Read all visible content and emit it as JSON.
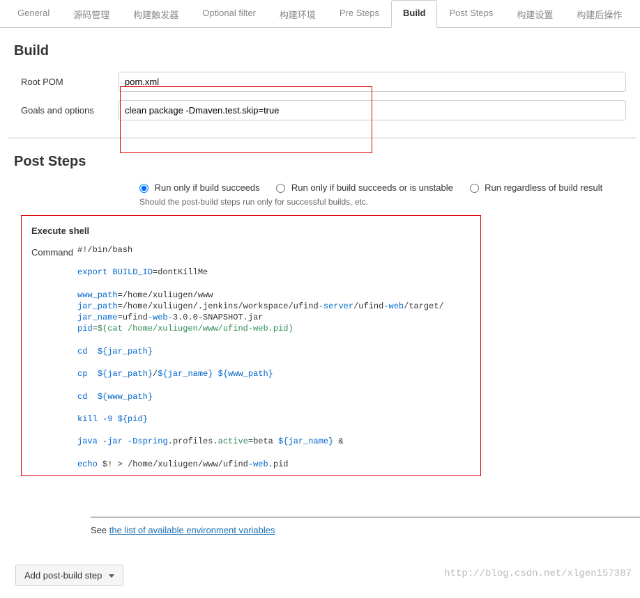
{
  "tabs": {
    "general": "General",
    "scm": "源码管理",
    "triggers": "构建触发器",
    "optional_filter": "Optional filter",
    "env": "构建环境",
    "pre_steps": "Pre Steps",
    "build": "Build",
    "post_steps": "Post Steps",
    "build_settings": "构建设置",
    "post_build": "构建后操作"
  },
  "build": {
    "title": "Build",
    "root_pom_label": "Root POM",
    "root_pom_value": "pom.xml",
    "goals_label": "Goals and options",
    "goals_value": "clean package -Dmaven.test.skip=true"
  },
  "post_steps": {
    "title": "Post Steps",
    "radio_succeeds": "Run only if build succeeds",
    "radio_unstable": "Run only if build succeeds or is unstable",
    "radio_regardless": "Run regardless of build result",
    "help_text": "Should the post-build steps run only for successful builds, etc.",
    "execute_shell_title": "Execute shell",
    "command_label": "Command",
    "shell": {
      "shebang": "#!/bin/bash",
      "export_kw": "export",
      "build_id_var": "BUILD_ID",
      "build_id_val": "dontKillMe",
      "www_path_var": "www_path",
      "www_path_val": "/home/xuliugen/www",
      "jar_path_var": "jar_path",
      "jar_path_val_pre": "/home/xuliugen/.jenkins/workspace/ufind",
      "jar_path_val_srv": "-server",
      "jar_path_val_mid": "/ufind",
      "jar_path_val_web": "-web",
      "jar_path_val_post": "/target/",
      "jar_name_var": "jar_name",
      "jar_name_val_pre": "ufind",
      "jar_name_val_web": "-web-",
      "jar_name_val_post": "3.0.0-SNAPSHOT.jar",
      "pid_var": "pid",
      "pid_val": "$(cat /home/xuliugen/www/ufind-web.pid)",
      "cd_cmd": "cd",
      "jar_path_ref": "${jar_path}",
      "cp_cmd": "cp",
      "jar_name_ref": "${jar_name}",
      "www_path_ref": "${www_path}",
      "kill_cmd": "kill",
      "kill_flag": "-9",
      "pid_ref": "${pid}",
      "java_cmd": "java",
      "jar_flag": "-jar",
      "dspring_flag": "-Dspring",
      "profiles": ".profiles.",
      "active_seg": "active",
      "beta_seg": "=beta",
      "amp": "&",
      "echo_cmd": "echo",
      "echo_arg": "$!",
      "gt": ">",
      "pid_file_path": "/home/xuliugen/www/ufind",
      "pid_file_web": "-web",
      "pid_file_ext": ".pid"
    },
    "see_text": "See ",
    "see_link": "the list of available environment variables"
  },
  "add_post_build_step": "Add post-build step",
  "watermark": "http://blog.csdn.net/xlgen157387"
}
